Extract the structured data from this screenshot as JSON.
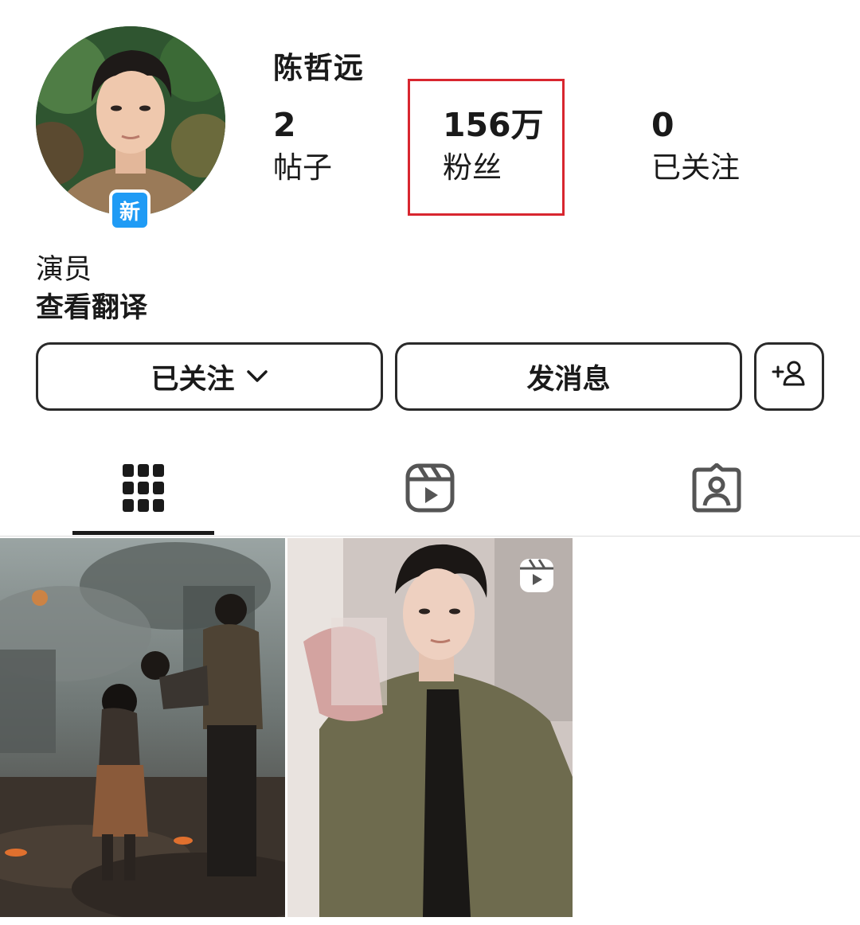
{
  "profile": {
    "username": "陈哲远",
    "badge": "新",
    "bio": "演员",
    "translate_label": "查看翻译"
  },
  "stats": {
    "posts": {
      "value": "2",
      "label": "帖子"
    },
    "followers": {
      "value": "156万",
      "label": "粉丝"
    },
    "following": {
      "value": "0",
      "label": "已关注"
    }
  },
  "actions": {
    "following_label": "已关注",
    "message_label": "发消息"
  },
  "tabs": [
    {
      "name": "posts",
      "icon": "grid-icon",
      "active": true
    },
    {
      "name": "reels",
      "icon": "reels-icon",
      "active": false
    },
    {
      "name": "tagged",
      "icon": "tagged-icon",
      "active": false
    }
  ],
  "posts": [
    {
      "kind": "photo"
    },
    {
      "kind": "reel",
      "icon": "reels-icon"
    }
  ],
  "colors": {
    "highlight": "#d8262f",
    "badge": "#1f9bf5",
    "text": "#1a1a1a"
  }
}
